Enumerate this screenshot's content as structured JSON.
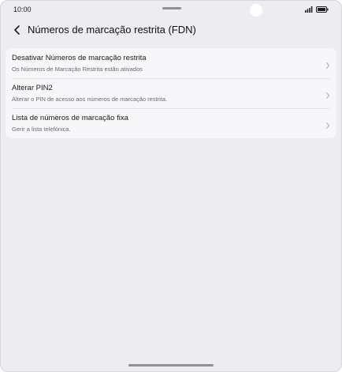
{
  "status_bar": {
    "time": "10:00",
    "icons": [
      "signal-icon",
      "battery-icon"
    ]
  },
  "header": {
    "back_icon": "chevron-left-icon",
    "title": "Números de marcação restrita (FDN)"
  },
  "settings": {
    "items": [
      {
        "title": "Desativar Números de marcação restrita",
        "subtitle": "Os Números de Marcação Restrita estão ativados"
      },
      {
        "title": "Alterar PIN2",
        "subtitle": "Alterar o PIN de acesso aos números de marcação restrita."
      },
      {
        "title": "Lista de números de marcação fixa",
        "subtitle": "Gerir a lista telefónica."
      }
    ]
  },
  "colors": {
    "background": "#ececf1",
    "card": "#f7f7fa",
    "text_primary": "#1a1a1a",
    "text_secondary": "#6a6a70"
  }
}
